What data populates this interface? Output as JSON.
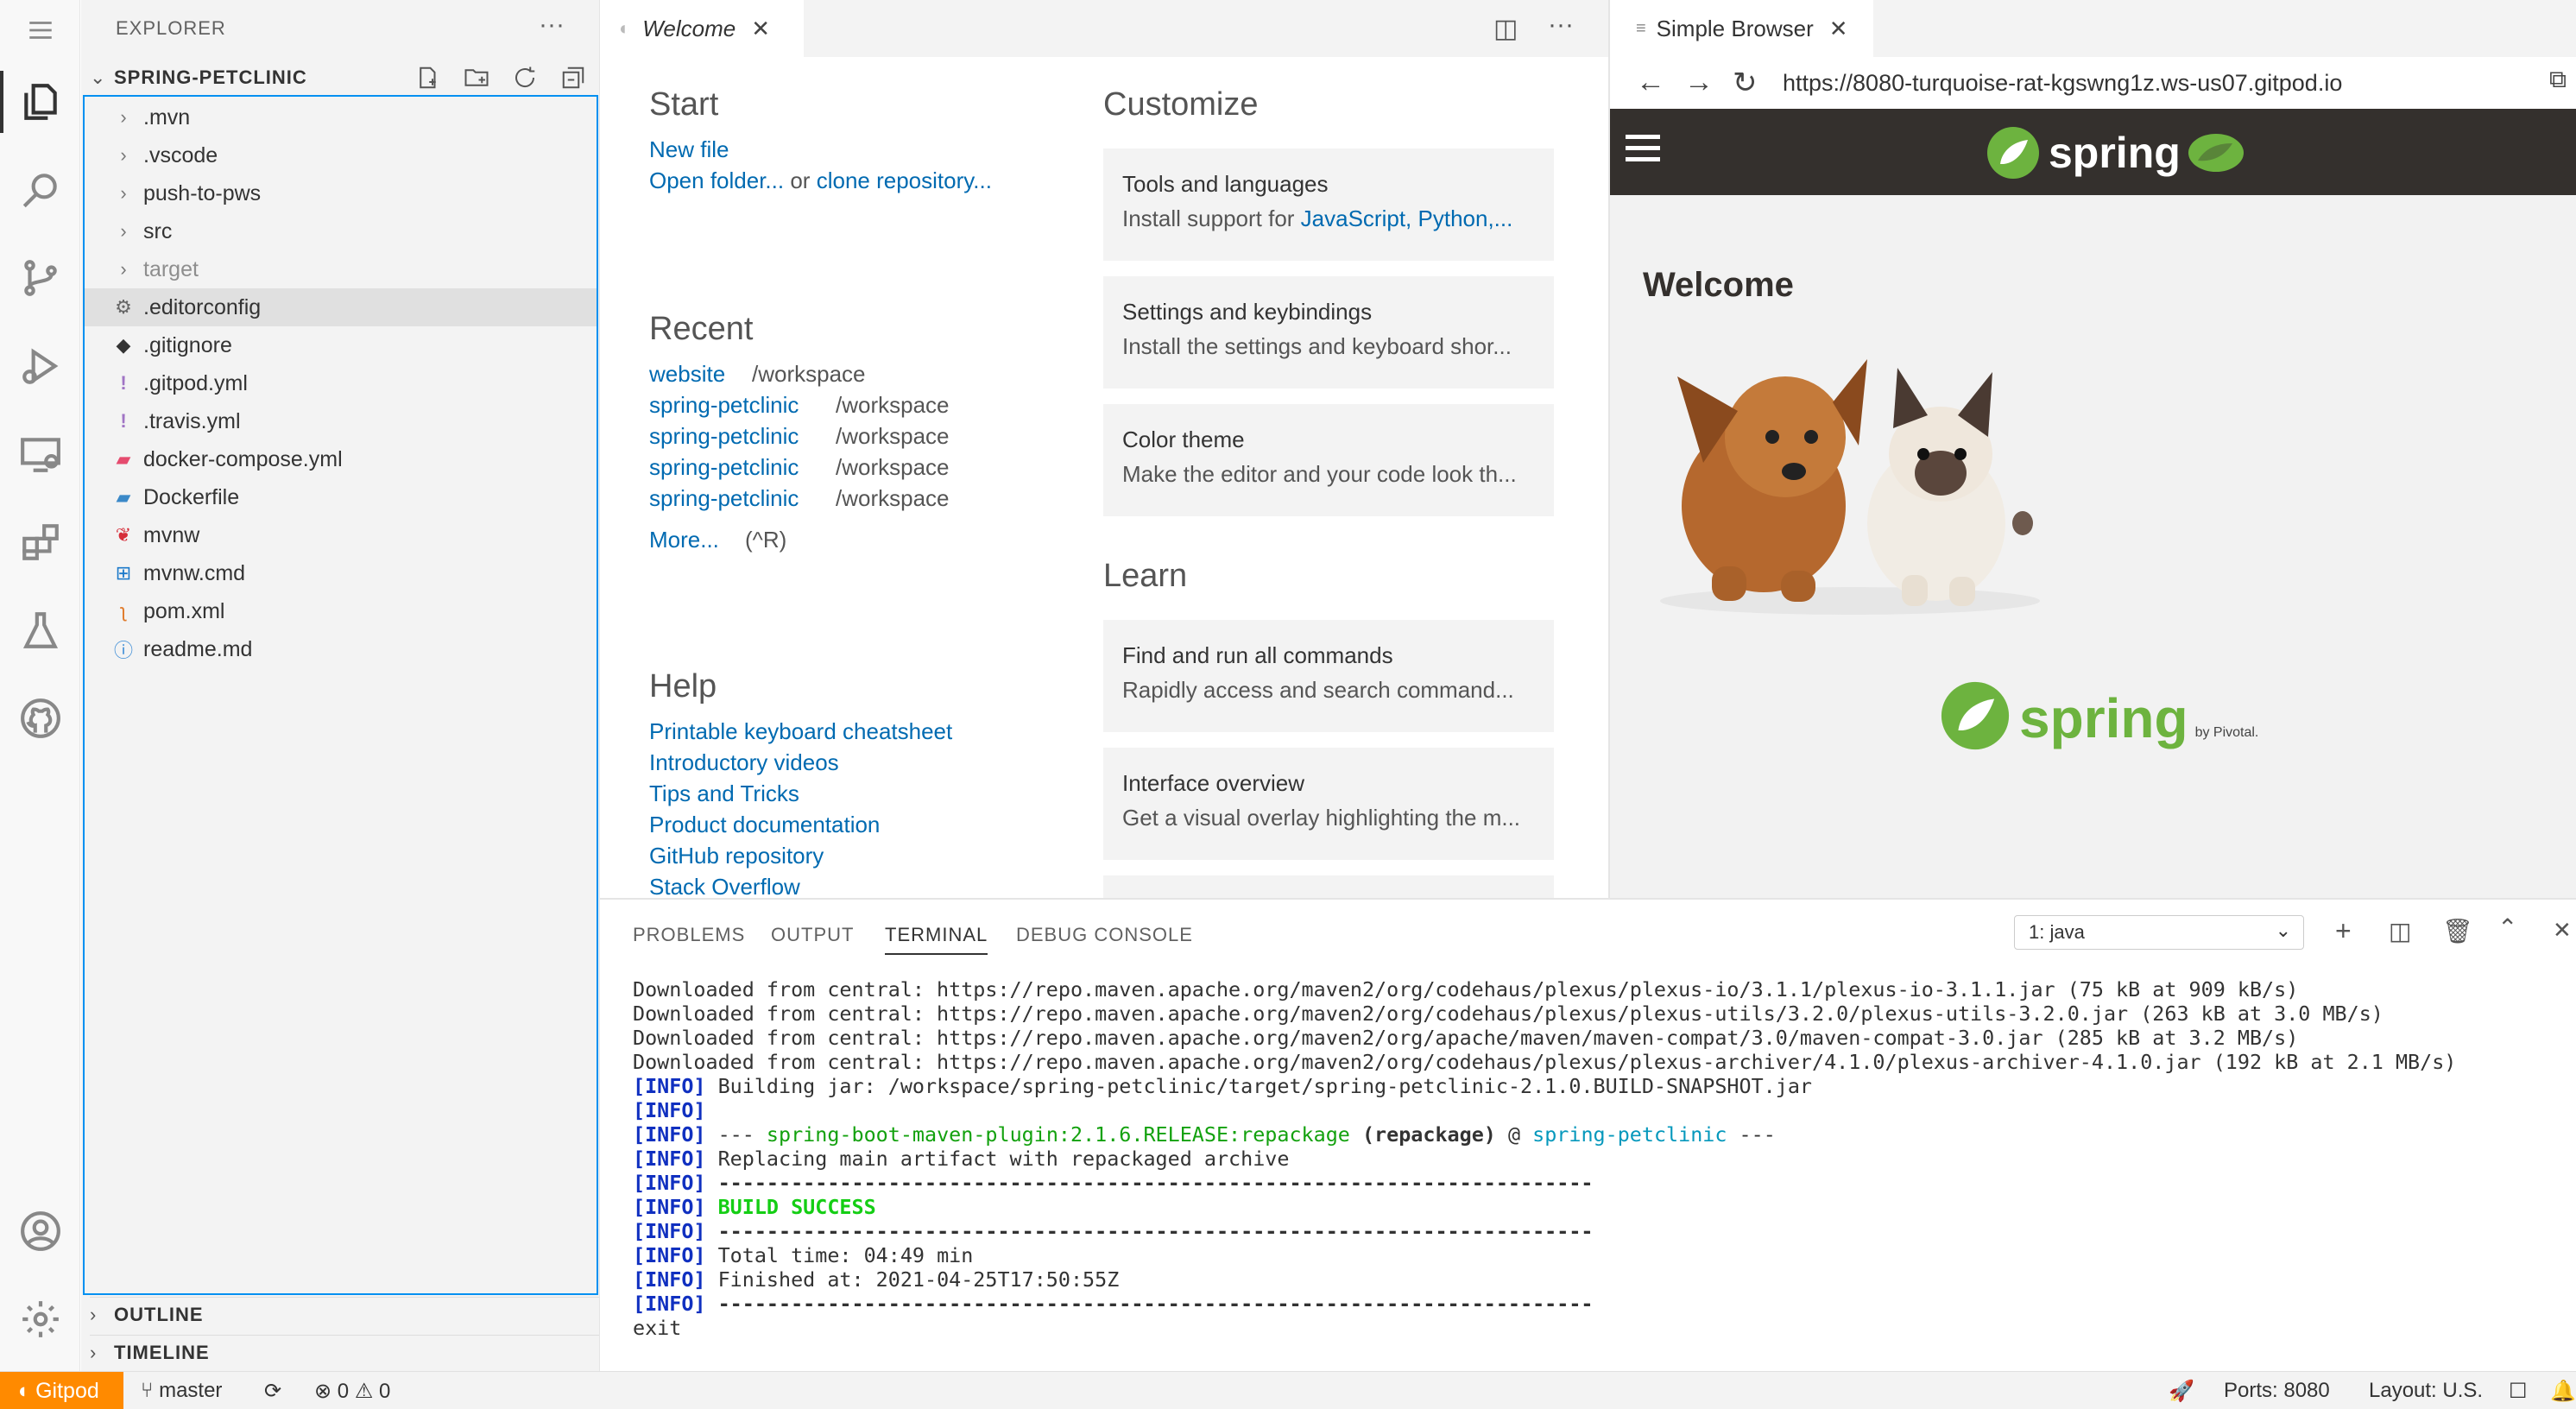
{
  "sidebar": {
    "title": "EXPLORER",
    "more": "···",
    "root_folder": "SPRING-PETCLINIC",
    "items": [
      {
        "label": ".mvn",
        "type": "folder"
      },
      {
        "label": ".vscode",
        "type": "folder"
      },
      {
        "label": "push-to-pws",
        "type": "folder"
      },
      {
        "label": "src",
        "type": "folder"
      },
      {
        "label": "target",
        "type": "folder"
      },
      {
        "label": ".editorconfig",
        "type": "gear"
      },
      {
        "label": ".gitignore",
        "type": "git"
      },
      {
        "label": ".gitpod.yml",
        "type": "yaml"
      },
      {
        "label": ".travis.yml",
        "type": "yaml"
      },
      {
        "label": "docker-compose.yml",
        "type": "docker"
      },
      {
        "label": "Dockerfile",
        "type": "docker"
      },
      {
        "label": "mvnw",
        "type": "maven"
      },
      {
        "label": "mvnw.cmd",
        "type": "windows"
      },
      {
        "label": "pom.xml",
        "type": "rss"
      },
      {
        "label": "readme.md",
        "type": "info"
      }
    ],
    "outline": "OUTLINE",
    "timeline": "TIMELINE"
  },
  "editor": {
    "tab_title": "Welcome",
    "start": {
      "heading": "Start",
      "new_file": "New file",
      "open_folder": "Open folder...",
      "or": "or",
      "clone": "clone repository..."
    },
    "recent": {
      "heading": "Recent",
      "items": [
        {
          "name": "website",
          "path": "/workspace"
        },
        {
          "name": "spring-petclinic",
          "path": "/workspace"
        },
        {
          "name": "spring-petclinic",
          "path": "/workspace"
        },
        {
          "name": "spring-petclinic",
          "path": "/workspace"
        },
        {
          "name": "spring-petclinic",
          "path": "/workspace"
        }
      ],
      "more": "More...",
      "shortcut": "(^R)"
    },
    "help": {
      "heading": "Help",
      "links": [
        "Printable keyboard cheatsheet",
        "Introductory videos",
        "Tips and Tricks",
        "Product documentation",
        "GitHub repository",
        "Stack Overflow"
      ]
    },
    "customize": {
      "heading": "Customize",
      "cards": [
        {
          "title": "Tools and languages",
          "desc_prefix": "Install support for ",
          "link1": "JavaScript",
          "sep": ", ",
          "link2": "Python",
          "suffix": ",..."
        },
        {
          "title": "Settings and keybindings",
          "desc": "Install the settings and keyboard shor..."
        },
        {
          "title": "Color theme",
          "desc": "Make the editor and your code look th..."
        }
      ]
    },
    "learn": {
      "heading": "Learn",
      "cards": [
        {
          "title": "Find and run all commands",
          "desc": "Rapidly access and search command..."
        },
        {
          "title": "Interface overview",
          "desc": "Get a visual overlay highlighting the m..."
        }
      ]
    }
  },
  "browser": {
    "tab_title": "Simple Browser",
    "url": "https://8080-turquoise-rat-kgswng1z.ws-us07.gitpod.io",
    "logo_text": "spring",
    "welcome": "Welcome",
    "footer_logo": "spring",
    "footer_by": "by Pivotal."
  },
  "panel": {
    "tabs": [
      "PROBLEMS",
      "OUTPUT",
      "TERMINAL",
      "DEBUG CONSOLE"
    ],
    "active_tab": "TERMINAL",
    "terminal_select": "1: java",
    "download_lines": [
      "Downloaded from central: https://repo.maven.apache.org/maven2/org/codehaus/plexus/plexus-io/3.1.1/plexus-io-3.1.1.jar (75 kB at 909 kB/s)",
      "Downloaded from central: https://repo.maven.apache.org/maven2/org/codehaus/plexus/plexus-utils/3.2.0/plexus-utils-3.2.0.jar (263 kB at 3.0 MB/s)",
      "Downloaded from central: https://repo.maven.apache.org/maven2/org/apache/maven/maven-compat/3.0/maven-compat-3.0.jar (285 kB at 3.2 MB/s)",
      "Downloaded from central: https://repo.maven.apache.org/maven2/org/codehaus/plexus/plexus-archiver/4.1.0/plexus-archiver-4.1.0.jar (192 kB at 2.1 MB/s)"
    ],
    "info_tag": "[INFO]",
    "building_jar": " Building jar: /workspace/spring-petclinic/target/spring-petclinic-2.1.0.BUILD-SNAPSHOT.jar",
    "plugin_prefix": " --- ",
    "plugin": "spring-boot-maven-plugin:2.1.6.RELEASE:repackage",
    "plugin_goal": " (repackage)",
    "plugin_at": " @ ",
    "plugin_project": "spring-petclinic",
    "plugin_suffix": " ---",
    "replacing": " Replacing main artifact with repackaged archive",
    "separator": " ------------------------------------------------------------------------",
    "build_success": " BUILD SUCCESS",
    "total_time": " Total time: 04:49 min",
    "finished_at": " Finished at: 2021-04-25T17:50:55Z",
    "exit": "exit"
  },
  "status": {
    "gitpod": "Gitpod",
    "branch": "master",
    "errors": "0",
    "warnings": "0",
    "ports": "Ports: 8080",
    "layout": "Layout: U.S."
  },
  "colors": {
    "accent_orange": "#ff8a00",
    "link": "#006ab1",
    "focus_border": "#0090f1",
    "spring_green": "#6db33f",
    "spring_bar": "#34302d"
  }
}
